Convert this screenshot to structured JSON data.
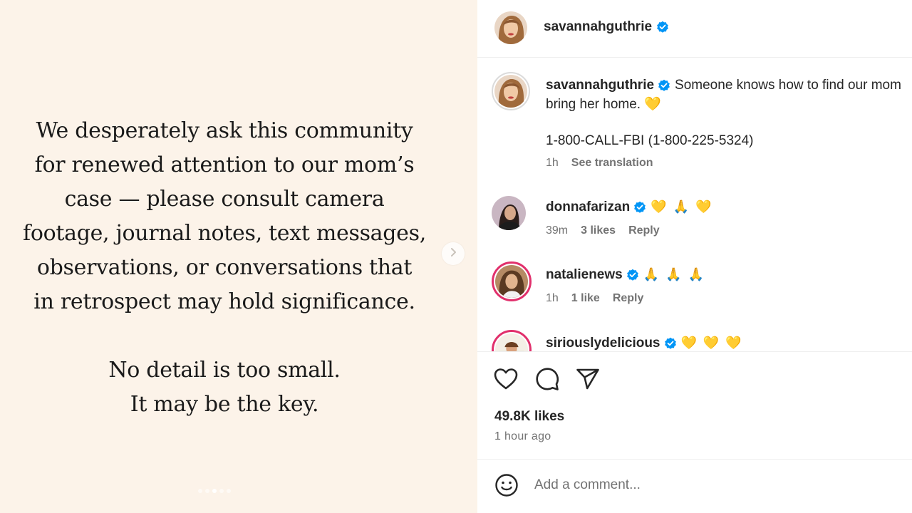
{
  "media": {
    "quote_lines": [
      "We desperately ask this community",
      "for renewed attention to our mom’s",
      "case — please consult camera",
      "footage, journal notes, text messages,",
      "observations, or conversations that",
      "in retrospect may hold significance."
    ],
    "quote2_lines": [
      "No detail is too small.",
      "It may be the key."
    ],
    "next_icon": "chevron-right-icon",
    "colors": {
      "background": "#fcf3e9",
      "text": "#1a1a1a"
    }
  },
  "header": {
    "username": "savannahguthrie",
    "verified": true
  },
  "caption": {
    "username": "savannahguthrie",
    "text_line1": "Someone knows how to find our mom",
    "text_line2": "bring her home. 💛",
    "phone": "1-800-CALL-FBI (1-800-225-5324)",
    "time": "1h",
    "see_translation": "See translation"
  },
  "comments": [
    {
      "username": "donnafarizan",
      "text": "💛 🙏 💛",
      "time": "39m",
      "likes": "3 likes",
      "reply": "Reply"
    },
    {
      "username": "natalienews",
      "text": "🙏 🙏 🙏",
      "time": "1h",
      "likes": "1 like",
      "reply": "Reply"
    },
    {
      "username": "siriouslydelicious",
      "text": "💛 💛 💛"
    }
  ],
  "actions": {
    "icons": [
      "heart-icon",
      "comment-icon",
      "share-icon"
    ],
    "likes": "49.8K likes",
    "time": "1 hour ago"
  },
  "add_comment": {
    "placeholder": "Add a comment...",
    "icon": "smile-icon"
  },
  "colors": {
    "verified": "#0095f6",
    "meta": "#737373",
    "text": "#262626",
    "story_ring": "#e1306c"
  }
}
